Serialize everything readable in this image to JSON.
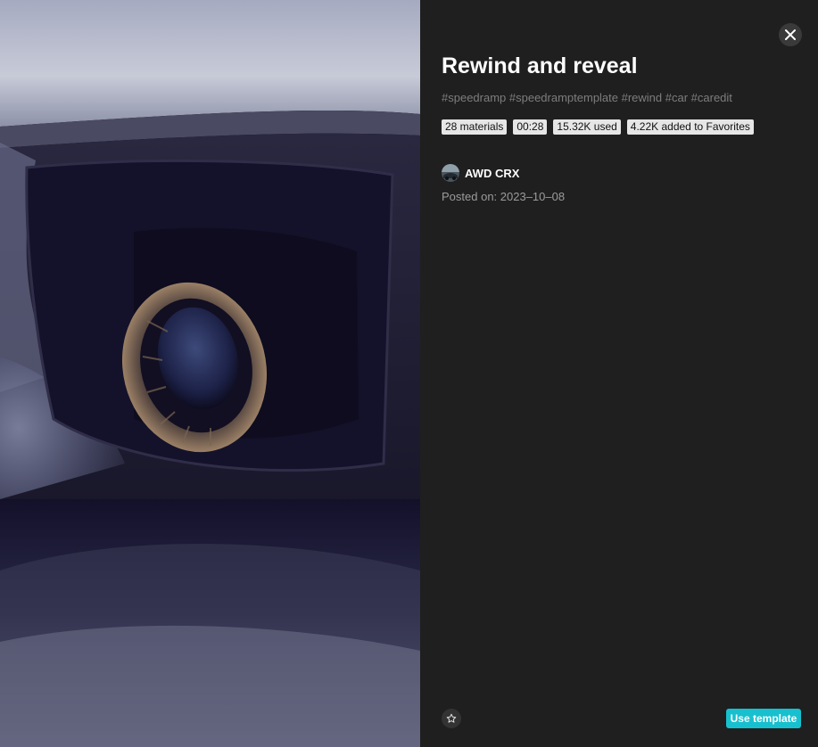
{
  "template": {
    "title": "Rewind and reveal",
    "tags": "#speedramp #speedramptemplate #rewind #car #caredit",
    "stats": {
      "materials": "28 materials",
      "duration": "00:28",
      "used": "15.32K used",
      "favorites": "4.22K added to Favorites"
    },
    "author": {
      "name": "AWD CRX"
    },
    "posted": "Posted on: 2023–10–08"
  },
  "actions": {
    "use_template": "Use template"
  },
  "icons": {
    "close": "close-icon",
    "favorite": "star-outline-icon"
  },
  "colors": {
    "panel_background": "#1f1f1f",
    "accent": "#17c0cf",
    "badge_background": "#e6e6e6",
    "tags_text": "#7d7d7d"
  }
}
